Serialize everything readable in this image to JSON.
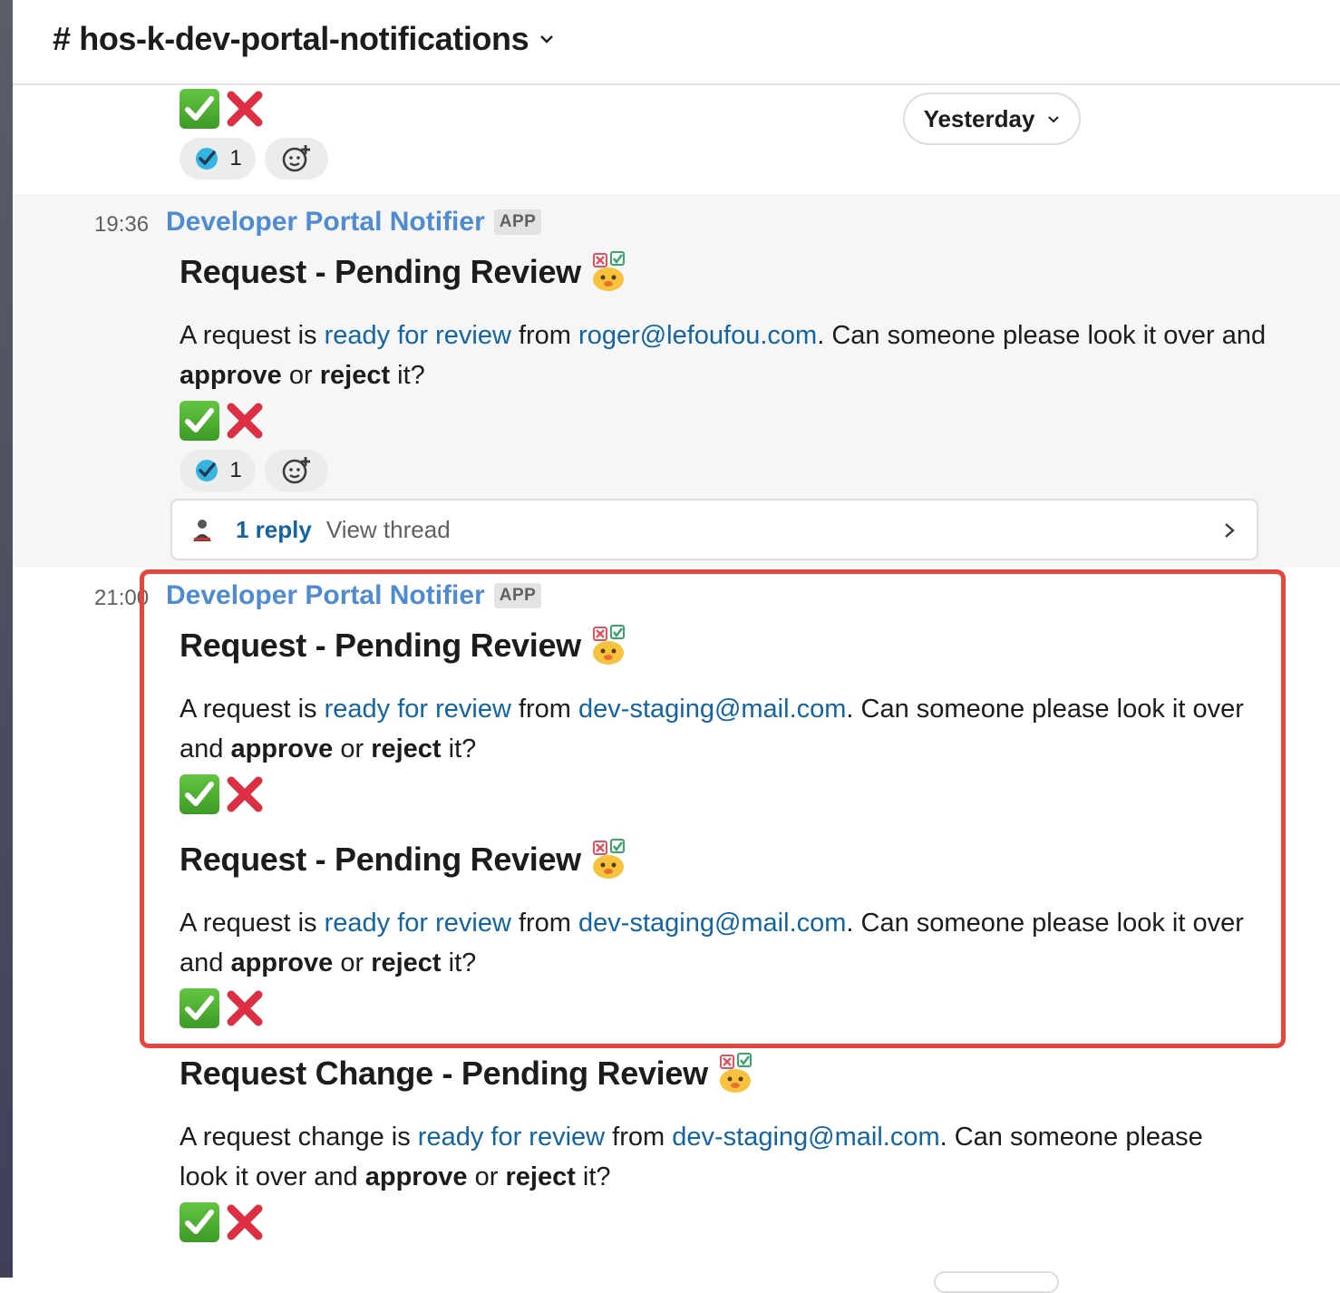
{
  "channel": {
    "title": "# hos-k-dev-portal-notifications"
  },
  "date_divider": {
    "label": "Yesterday"
  },
  "reactions": {
    "check_count": "1"
  },
  "messages": [
    {
      "time": "19:36",
      "sender": "Developer Portal Notifier",
      "badge": "APP",
      "blocks": [
        {
          "heading": "Request - Pending Review",
          "p1": "A request is ",
          "link": "ready for review",
          "p2": " from ",
          "email": "roger@lefoufou.com",
          "p3": ".  Can someone please look it over and ",
          "approve": "approve",
          "p4": " or ",
          "reject": "reject",
          "p5": " it?"
        }
      ],
      "thread": {
        "reply": "1 reply",
        "view": "View thread"
      }
    },
    {
      "time": "21:00",
      "sender": "Developer Portal Notifier",
      "badge": "APP",
      "blocks": [
        {
          "heading": "Request - Pending Review",
          "p1": "A request is ",
          "link": "ready for review",
          "p2": " from ",
          "email": "dev-staging@mail.com",
          "p3": ".  Can someone please look it over and ",
          "approve": "approve",
          "p4": " or ",
          "reject": "reject",
          "p5": " it?"
        },
        {
          "heading": "Request - Pending Review",
          "p1": "A request is ",
          "link": "ready for review",
          "p2": " from ",
          "email": "dev-staging@mail.com",
          "p3": ".  Can someone please look it over and ",
          "approve": "approve",
          "p4": " or ",
          "reject": "reject",
          "p5": " it?"
        },
        {
          "heading": "Request Change - Pending Review",
          "p1": "A request change is ",
          "link": "ready for review",
          "p2": " from ",
          "email": "dev-staging@mail.com",
          "p3": ".  Can someone please look it over and ",
          "approve": "approve",
          "p4": " or ",
          "reject": "reject",
          "p5": " it?"
        }
      ]
    }
  ]
}
